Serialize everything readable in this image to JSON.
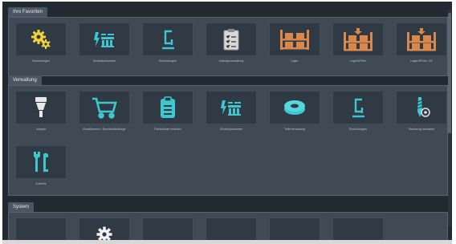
{
  "sections": [
    {
      "title": "Ihre Favoriten"
    },
    {
      "title": "Verwaltung"
    },
    {
      "title": "System"
    }
  ],
  "favorites": [
    {
      "label": "Einstellungen",
      "icon": "gears-icon"
    },
    {
      "label": "Einstellparameter",
      "icon": "parameters-icon"
    },
    {
      "label": "Einrichtungen",
      "icon": "clamp-icon"
    },
    {
      "label": "Auftragsverwaltung",
      "icon": "clipboard-list-icon"
    },
    {
      "label": "Lager",
      "icon": "shelf-icon"
    },
    {
      "label": "Lager&Prüfu",
      "icon": "shelf-add-icon"
    },
    {
      "label": "Lager&Prüfu. 2/2",
      "icon": "shelf-add-icon"
    }
  ],
  "management": [
    {
      "label": "Adapter",
      "icon": "adapter-icon"
    },
    {
      "label": "Bestellwesen / Bereitstellaufträge",
      "icon": "cart-icon"
    },
    {
      "label": "Einrichtblatt erstellen",
      "icon": "clipboard-icon"
    },
    {
      "label": "Einstellparameter",
      "icon": "parameters-icon"
    },
    {
      "label": "Tellerverwaltung",
      "icon": "plate-icon"
    },
    {
      "label": "Einrichtungen",
      "icon": "clamp-icon"
    },
    {
      "label": "Werkzeug verwalten",
      "icon": "drill-settings-icon"
    },
    {
      "label": "Zubehör",
      "icon": "wrench-tools-icon"
    }
  ],
  "system": [
    {
      "label": "",
      "icon": ""
    },
    {
      "label": "",
      "icon": "gear-icon"
    },
    {
      "label": "",
      "icon": ""
    },
    {
      "label": "",
      "icon": ""
    },
    {
      "label": "",
      "icon": ""
    },
    {
      "label": "",
      "icon": ""
    }
  ],
  "colors": {
    "teal": "#3fc7cf",
    "orange": "#d9874a",
    "yellow": "#f0d23a",
    "white": "#f2f2f2",
    "background": "#212a31",
    "panel": "#3f4a54",
    "tile": "#2f3a44"
  }
}
